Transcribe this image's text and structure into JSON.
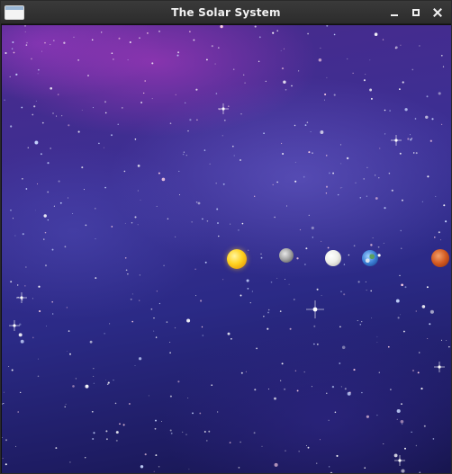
{
  "window": {
    "title": "The Solar System"
  },
  "scene": {
    "background": "starfield-nebula",
    "accent_colors": {
      "nebula_purple": "#7a3aa8",
      "space_blue": "#2b2a86"
    },
    "planets": [
      {
        "name": "sun",
        "icon": "sun-icon"
      },
      {
        "name": "mercury",
        "icon": "mercury-icon"
      },
      {
        "name": "venus",
        "icon": "venus-icon"
      },
      {
        "name": "earth",
        "icon": "earth-icon"
      },
      {
        "name": "mars",
        "icon": "mars-icon"
      }
    ]
  }
}
